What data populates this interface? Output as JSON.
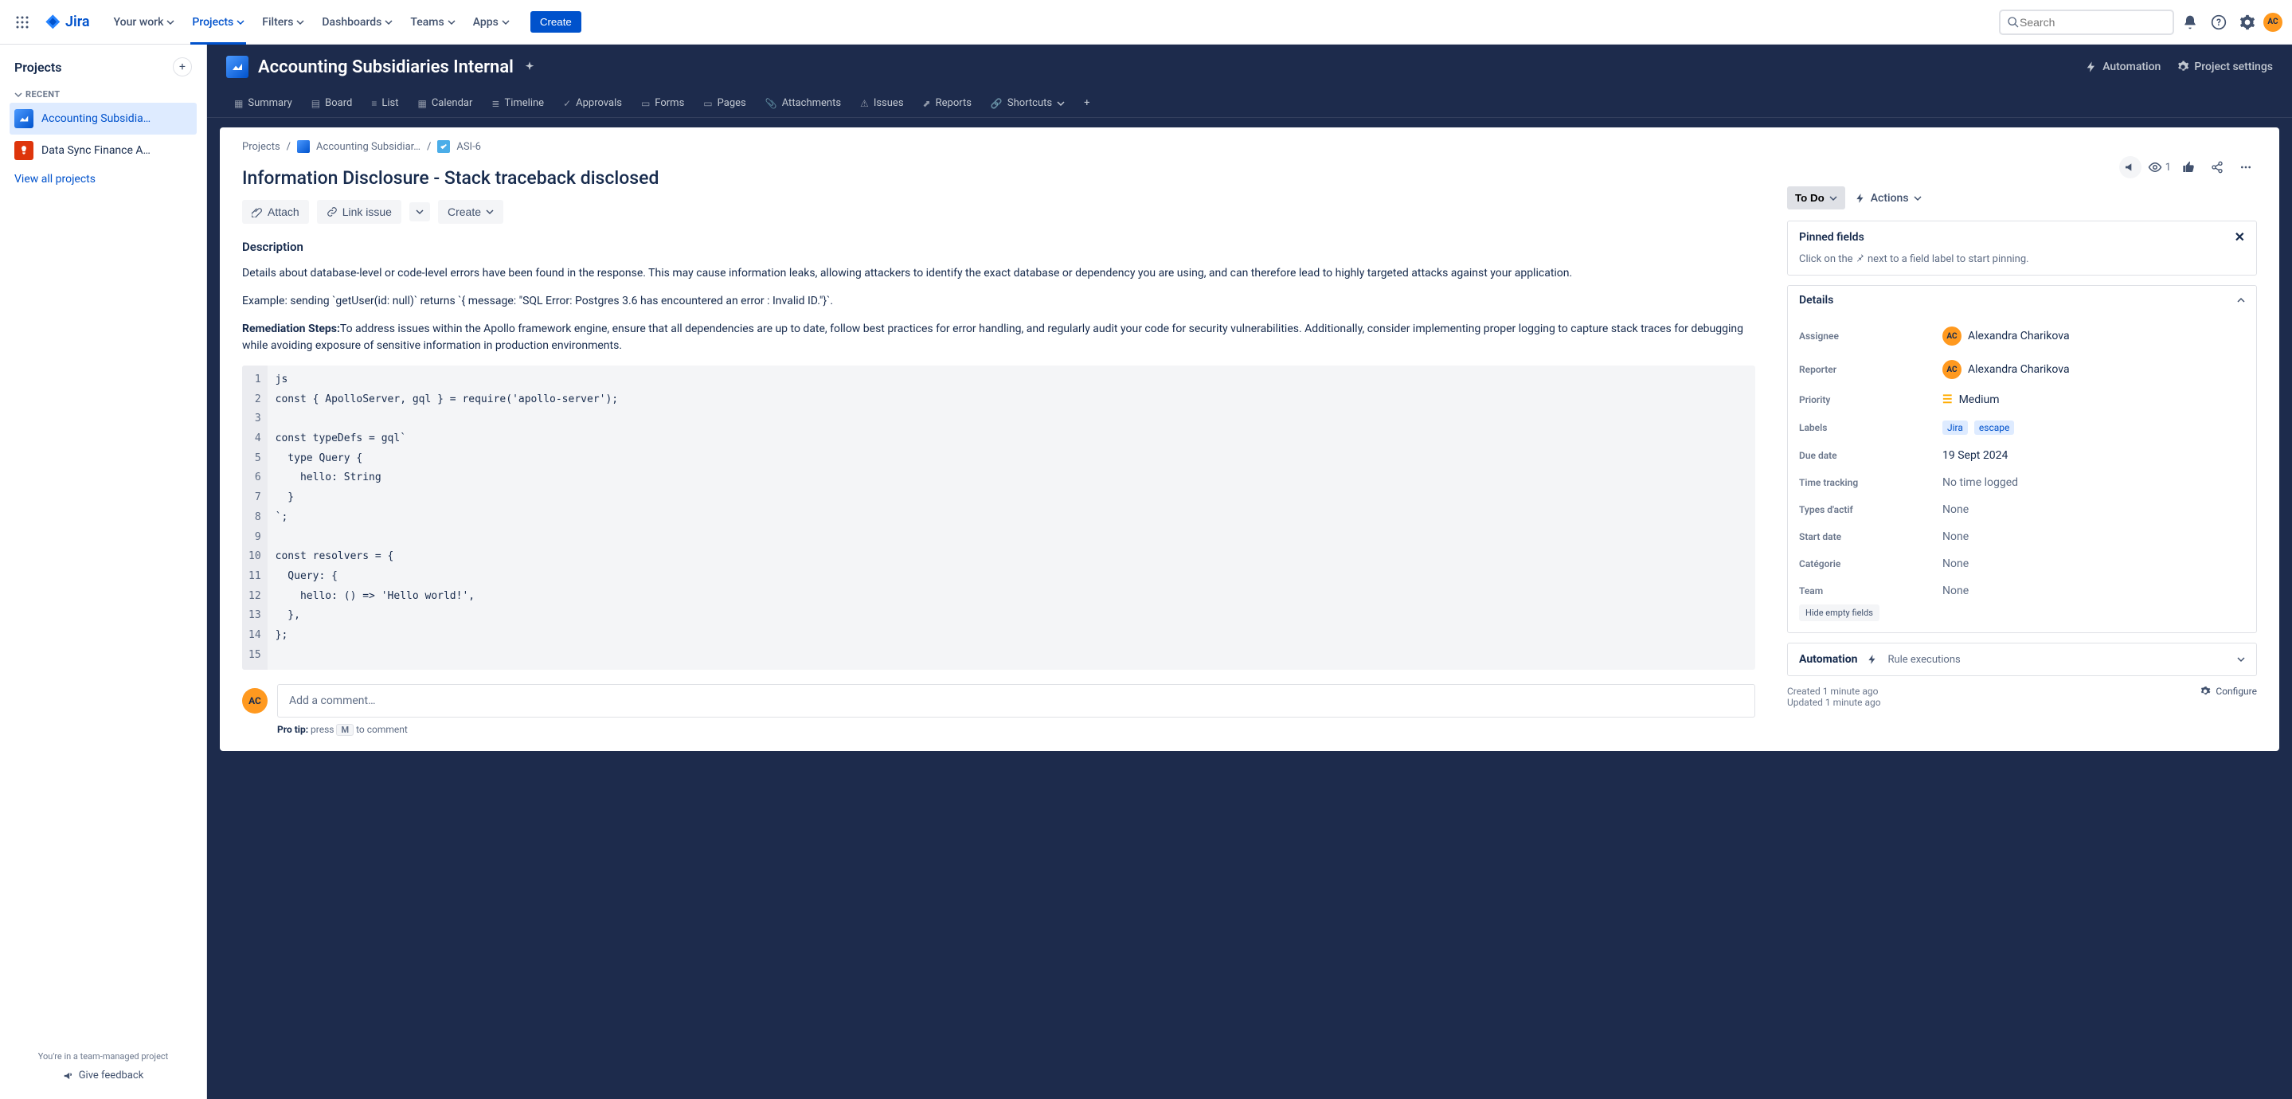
{
  "nav": {
    "product": "Jira",
    "items": [
      "Your work",
      "Projects",
      "Filters",
      "Dashboards",
      "Teams",
      "Apps"
    ],
    "create": "Create",
    "search_placeholder": "Search",
    "avatar_initials": "AC"
  },
  "sidebar": {
    "title": "Projects",
    "recent": "RECENT",
    "projects": [
      {
        "name": "Accounting Subsidia…",
        "color": "blue"
      },
      {
        "name": "Data Sync Finance A…",
        "color": "red"
      }
    ],
    "view_all": "View all projects",
    "team_managed": "You're in a team-managed project",
    "feedback": "Give feedback"
  },
  "project": {
    "name": "Accounting Subsidiaries Internal",
    "header_actions": {
      "automation": "Automation",
      "settings": "Project settings"
    },
    "tabs": [
      "Summary",
      "Board",
      "List",
      "Calendar",
      "Timeline",
      "Approvals",
      "Forms",
      "Pages",
      "Attachments",
      "Issues",
      "Reports",
      "Shortcuts"
    ]
  },
  "crumbs": {
    "root": "Projects",
    "project": "Accounting Subsidiar…",
    "issue": "ASI-6"
  },
  "issue": {
    "title": "Information Disclosure - Stack traceback disclosed",
    "buttons": {
      "attach": "Attach",
      "link": "Link issue",
      "create": "Create"
    },
    "description_label": "Description",
    "desc_p1": "Details about database-level or code-level errors have been found in the response. This may cause information leaks, allowing attackers to identify the exact database or dependency you are using, and can therefore lead to highly targeted attacks against your application.",
    "desc_p2": "Example: sending `getUser(id: null)` returns `{ message: \"SQL Error: Postgres 3.6 has encountered an error : Invalid ID.\"}`.",
    "remediation_label": "Remediation Steps:",
    "remediation_text": "To address issues within the Apollo framework engine, ensure that all dependencies are up to date, follow best practices for error handling, and regularly audit your code for security vulnerabilities. Additionally, consider implementing proper logging to capture stack traces for debugging while avoiding exposure of sensitive information in production environments.",
    "code_lines": [
      "js",
      "const { ApolloServer, gql } = require('apollo-server');",
      "",
      "const typeDefs = gql`",
      "  type Query {",
      "    hello: String",
      "  }",
      "`;",
      "",
      "const resolvers = {",
      "  Query: {",
      "    hello: () => 'Hello world!',",
      "  },",
      "};",
      ""
    ],
    "comment_placeholder": "Add a comment…",
    "protip_pre": "Pro tip:",
    "protip_mid": " press ",
    "protip_key": "M",
    "protip_post": " to comment"
  },
  "right": {
    "watch_count": "1",
    "status": "To Do",
    "actions": "Actions",
    "pinned_title": "Pinned fields",
    "pinned_hint_pre": "Click on the ",
    "pinned_hint_post": " next to a field label to start pinning.",
    "details_title": "Details",
    "fields": {
      "assignee": {
        "label": "Assignee",
        "value": "Alexandra Charikova"
      },
      "reporter": {
        "label": "Reporter",
        "value": "Alexandra Charikova"
      },
      "priority": {
        "label": "Priority",
        "value": "Medium"
      },
      "labels": {
        "label": "Labels",
        "values": [
          "Jira",
          "escape"
        ]
      },
      "due": {
        "label": "Due date",
        "value": "19 Sept 2024"
      },
      "time": {
        "label": "Time tracking",
        "value": "No time logged"
      },
      "types_dactif": {
        "label": "Types d'actif",
        "value": "None"
      },
      "start": {
        "label": "Start date",
        "value": "None"
      },
      "categorie": {
        "label": "Catégorie",
        "value": "None"
      },
      "team": {
        "label": "Team",
        "value": "None"
      }
    },
    "hide_empty": "Hide empty fields",
    "automation_label": "Automation",
    "rule_exec": "Rule executions",
    "created": "Created 1 minute ago",
    "updated": "Updated 1 minute ago",
    "configure": "Configure"
  }
}
